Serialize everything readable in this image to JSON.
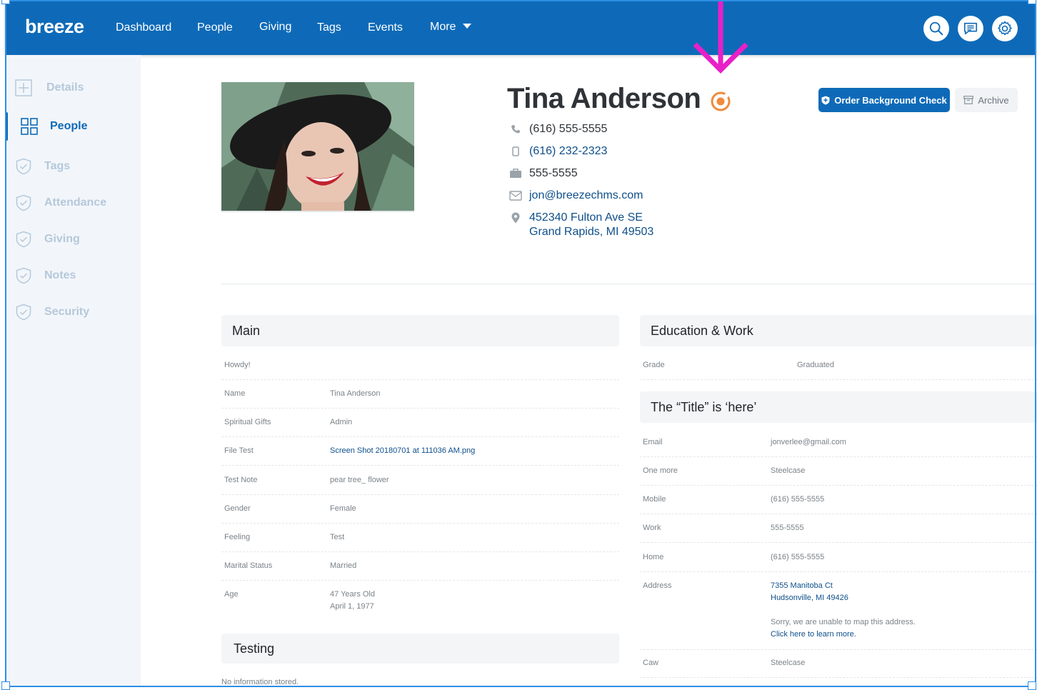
{
  "app": {
    "logo": "breeze",
    "nav": [
      "Dashboard",
      "People",
      "Giving",
      "Tags",
      "Events"
    ],
    "nav_more": "More",
    "colors": {
      "primary": "#0e6ab8",
      "annotation_arrow": "#e91fc8",
      "badge": "#f08a3c"
    },
    "icons": {
      "search": "search-icon",
      "messages": "message-icon",
      "settings": "gear-icon"
    }
  },
  "sidebar": {
    "items": [
      "Details",
      "People",
      "Tags",
      "Attendance",
      "Giving",
      "Notes",
      "Security"
    ]
  },
  "profile": {
    "name": "Tina Anderson",
    "phone_home": "(616) 555-5555",
    "phone_mobile": "(616) 232-2323",
    "phone_work": "555-5555",
    "email": "jon@breezechms.com",
    "address_line1": "452340 Fulton Ave SE",
    "address_line2": "Grand Rapids, MI 49503",
    "actions": {
      "background_check": "Order Background Check",
      "archive": "Archive"
    }
  },
  "main_panel": {
    "title": "Main",
    "intro": "Howdy!",
    "rows": [
      {
        "label": "Name",
        "value": "Tina Anderson"
      },
      {
        "label": "Spiritual Gifts",
        "value": "Admin"
      },
      {
        "label": "File Test",
        "value": "Screen Shot 20180701 at 111036 AM.png"
      },
      {
        "label": "Test Note",
        "value": "pear tree_ flower"
      },
      {
        "label": "Gender",
        "value": "Female"
      },
      {
        "label": "Feeling",
        "value": "Test"
      },
      {
        "label": "Marital Status",
        "value": "Married"
      },
      {
        "label": "Age",
        "value": "47 Years Old",
        "value2": "April 1, 1977"
      }
    ]
  },
  "testing_panel": {
    "title": "Testing",
    "empty": "No information stored."
  },
  "education_panel": {
    "title": "Education & Work",
    "rows": [
      {
        "label": "Grade",
        "value": "Graduated"
      }
    ]
  },
  "title_panel": {
    "title": "The “Title” is ‘here’",
    "rows": [
      {
        "label": "Email",
        "value": "jonverlee@gmail.com"
      },
      {
        "label": "One more",
        "value": "Steelcase"
      },
      {
        "label": "Mobile",
        "value": "(616) 555-5555"
      },
      {
        "label": "Work",
        "value": "555-5555"
      },
      {
        "label": "Home",
        "value": "(616) 555-5555"
      },
      {
        "label": "Address",
        "value": "7355 Manitoba Ct",
        "value2": "Hudsonville, MI 49426",
        "note": "Sorry, we are unable to map this address.",
        "note_link": "Click here to learn more."
      },
      {
        "label": "Caw",
        "value": "Steelcase"
      }
    ]
  }
}
